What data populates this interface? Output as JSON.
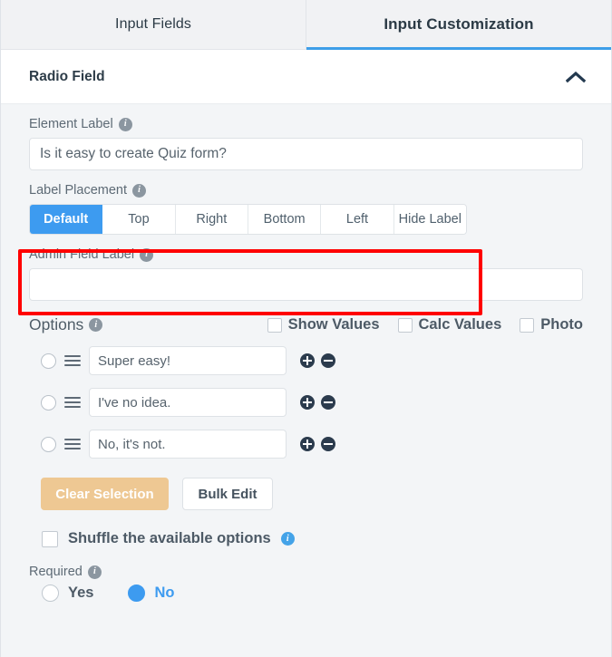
{
  "tabs": [
    {
      "label": "Input Fields",
      "active": false
    },
    {
      "label": "Input Customization",
      "active": true
    }
  ],
  "panel": {
    "title": "Radio Field",
    "collapse_icon": "chevron-up-icon"
  },
  "element_label": {
    "label": "Element Label",
    "info_icon": "info-icon",
    "value": "Is it easy to create Quiz form?",
    "placeholder": ""
  },
  "label_placement": {
    "label": "Label Placement",
    "info_icon": "info-icon",
    "highlighted": true,
    "highlight_color": "#ff0000",
    "active_color": "#3d9bf0",
    "options": [
      {
        "label": "Default",
        "selected": true
      },
      {
        "label": "Top",
        "selected": false
      },
      {
        "label": "Right",
        "selected": false
      },
      {
        "label": "Bottom",
        "selected": false
      },
      {
        "label": "Left",
        "selected": false
      },
      {
        "label": "Hide Label",
        "selected": false
      }
    ]
  },
  "admin_field_label": {
    "label": "Admin Field Label",
    "info_icon": "info-icon",
    "value": "",
    "placeholder": ""
  },
  "options_section": {
    "label": "Options",
    "info_icon": "info-icon",
    "checkboxes": [
      {
        "label": "Show Values",
        "checked": false
      },
      {
        "label": "Calc Values",
        "checked": false
      },
      {
        "label": "Photo",
        "checked": false
      }
    ],
    "rows": [
      {
        "value": "Super easy!",
        "selected": false,
        "drag_icon": "drag-handle-icon",
        "add_icon": "plus-circle-icon",
        "remove_icon": "minus-circle-icon"
      },
      {
        "value": "I've no idea.",
        "selected": false,
        "drag_icon": "drag-handle-icon",
        "add_icon": "plus-circle-icon",
        "remove_icon": "minus-circle-icon"
      },
      {
        "value": "No, it's not.",
        "selected": false,
        "drag_icon": "drag-handle-icon",
        "add_icon": "plus-circle-icon",
        "remove_icon": "minus-circle-icon"
      }
    ],
    "clear_button": "Clear Selection",
    "clear_button_color": "#eec893",
    "bulk_button": "Bulk Edit"
  },
  "shuffle": {
    "label": "Shuffle the available options",
    "checked": false,
    "info_icon": "info-icon-blue"
  },
  "required": {
    "label": "Required",
    "info_icon": "info-icon",
    "options": [
      {
        "label": "Yes",
        "selected": false
      },
      {
        "label": "No",
        "selected": true
      }
    ]
  }
}
